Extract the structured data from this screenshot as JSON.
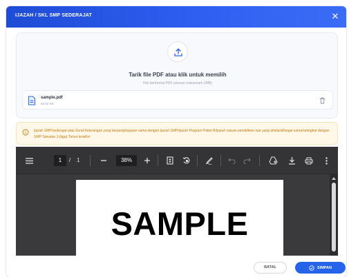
{
  "modal": {
    "title": "IJAZAH / SKL SMP SEDERAJAT",
    "close_symbol": "✕"
  },
  "dropzone": {
    "title": "Tarik file PDF atau klik untuk memilih",
    "hint": "File berformat PDF (ukuran maksimum 2MB)",
    "upload_icon": "upload-icon"
  },
  "file": {
    "name": "sample.pdf",
    "size": "66.82 KB",
    "icon": "document-icon",
    "delete_icon": "trash-icon"
  },
  "notice": {
    "icon": "info-icon",
    "text": "Ijazah SMP/sederajat atau Surat Keterangan yang berpenghargaan sama dengan Ijazah SMP/Ijazah Program Paket B/Ijazah satuan pendidikan luar yang dinilai/dihargai sama/setingkat dengan SMP Tamatan 3 (tiga) Tahun terakhir",
    "color": "#c2790b"
  },
  "viewer": {
    "current_page": "1",
    "separator": "/",
    "total_pages": "1",
    "zoom": "38%",
    "page_text": "SAMPLE"
  },
  "actions": {
    "cancel_label": "BATAL",
    "save_label": "SIMPAN"
  },
  "colors": {
    "header_gradient_start": "#1f4cd6",
    "primary": "#2563eb",
    "notice_bg": "#fff8e8",
    "viewer_bg": "#3a3a3c"
  }
}
